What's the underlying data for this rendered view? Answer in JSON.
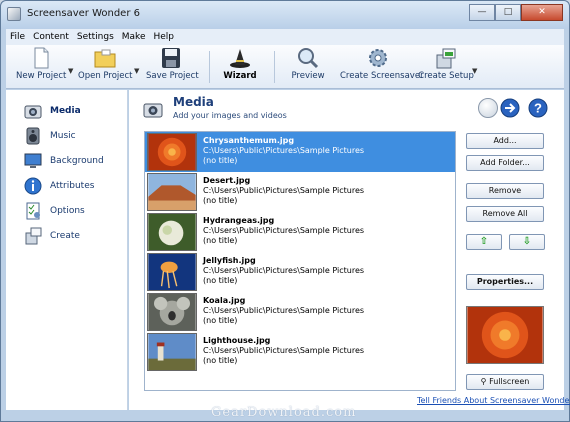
{
  "window": {
    "title": "Screensaver Wonder 6"
  },
  "menu": [
    "File",
    "Content",
    "Settings",
    "Make",
    "Help"
  ],
  "toolbar": {
    "new_project": "New Project",
    "open_project": "Open Project",
    "save_project": "Save Project",
    "wizard": "Wizard",
    "preview": "Preview",
    "create_screensaver": "Create Screensaver",
    "create_setup": "Create Setup"
  },
  "sidebar": {
    "items": [
      {
        "label": "Media",
        "icon": "camera-icon",
        "active": true
      },
      {
        "label": "Music",
        "icon": "speaker-icon",
        "active": false
      },
      {
        "label": "Background",
        "icon": "monitor-icon",
        "active": false
      },
      {
        "label": "Attributes",
        "icon": "info-icon",
        "active": false
      },
      {
        "label": "Options",
        "icon": "checklist-icon",
        "active": false
      },
      {
        "label": "Create",
        "icon": "install-box-icon",
        "active": false
      }
    ]
  },
  "content": {
    "title": "Media",
    "subtitle": "Add your images and videos"
  },
  "files": [
    {
      "name": "Chrysanthemum.jpg",
      "path": "C:\\Users\\Public\\Pictures\\Sample Pictures",
      "title": "(no title)",
      "selected": true,
      "thumb_color": "#d2410f"
    },
    {
      "name": "Desert.jpg",
      "path": "C:\\Users\\Public\\Pictures\\Sample Pictures",
      "title": "(no title)",
      "selected": false,
      "thumb_color": "#b0582c"
    },
    {
      "name": "Hydrangeas.jpg",
      "path": "C:\\Users\\Public\\Pictures\\Sample Pictures",
      "title": "(no title)",
      "selected": false,
      "thumb_color": "#6f8c4a"
    },
    {
      "name": "Jellyfish.jpg",
      "path": "C:\\Users\\Public\\Pictures\\Sample Pictures",
      "title": "(no title)",
      "selected": false,
      "thumb_color": "#1b3f8c"
    },
    {
      "name": "Koala.jpg",
      "path": "C:\\Users\\Public\\Pictures\\Sample Pictures",
      "title": "(no title)",
      "selected": false,
      "thumb_color": "#7d8079"
    },
    {
      "name": "Lighthouse.jpg",
      "path": "C:\\Users\\Public\\Pictures\\Sample Pictures",
      "title": "(no title)",
      "selected": false,
      "thumb_color": "#4f78b8"
    }
  ],
  "buttons": {
    "add": "Add...",
    "add_folder": "Add Folder...",
    "remove": "Remove",
    "remove_all": "Remove All",
    "properties": "Properties...",
    "fullscreen": "Fullscreen"
  },
  "link": "Tell Friends About Screensaver Wonder 6",
  "watermark": "GearDownload.com",
  "colors": {
    "selection": "#3f8ee0",
    "accent": "#1e3f7a"
  }
}
